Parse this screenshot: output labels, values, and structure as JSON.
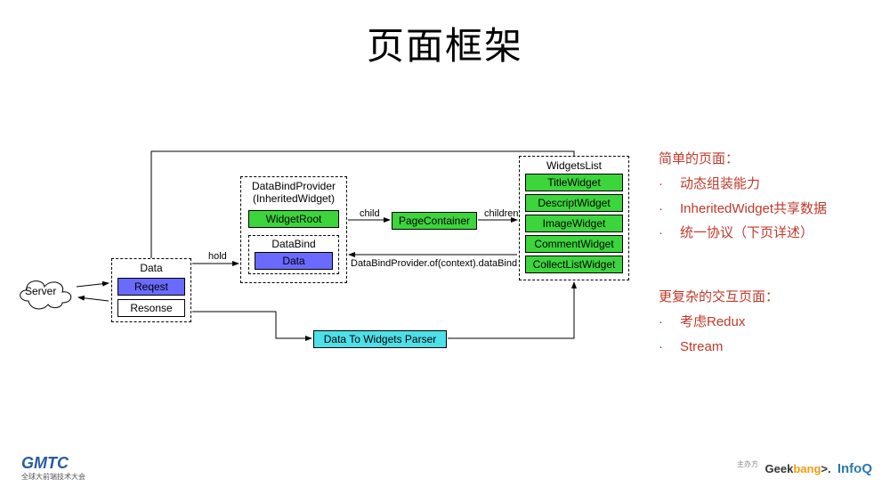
{
  "title": "页面框架",
  "diagram": {
    "server": "Server",
    "data_box": {
      "title": "Data",
      "request": "Reqest",
      "response": "Resonse"
    },
    "provider_box": {
      "title1": "DataBindProvider",
      "title2": "(InheritedWidget)",
      "root": "WidgetRoot",
      "bind_title": "DataBind",
      "bind_data": "Data"
    },
    "page_container": "PageContainer",
    "widgets_list": {
      "title": "WidgetsList",
      "items": [
        "TitleWidget",
        "DescriptWidget",
        "ImageWidget",
        "CommentWidget",
        "CollectListWidget"
      ]
    },
    "parser": "Data To Widgets Parser",
    "labels": {
      "hold": "hold",
      "child": "child",
      "children": "children",
      "databind_of": "DataBindProvider.of(context).dataBind"
    }
  },
  "notes": {
    "simple_title": "简单的页面：",
    "simple_items": [
      "动态组装能力",
      "InheritedWidget共享数据",
      "统一协议（下页详述）"
    ],
    "complex_title": "更复杂的交互页面：",
    "complex_items": [
      "考虑Redux",
      "Stream"
    ]
  },
  "footer": {
    "gmtc": "GMTC",
    "gmtc_sub": "全球大前端技术大会",
    "host": "主办方",
    "geekbang": "Geekbang",
    "infoq": "InfoQ"
  }
}
